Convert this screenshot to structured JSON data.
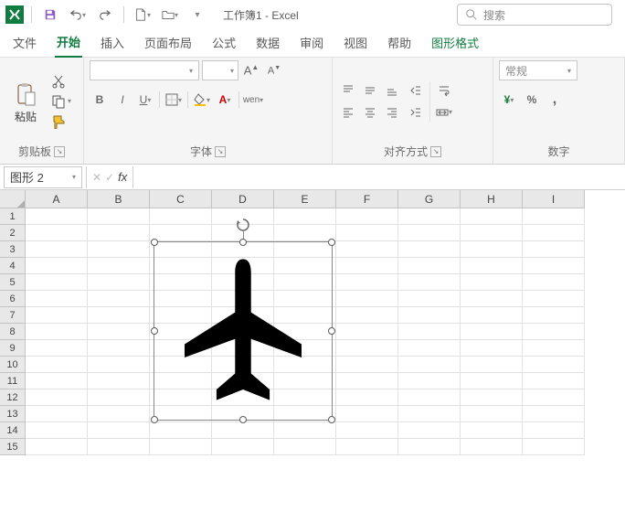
{
  "title": "工作簿1 - Excel",
  "search": {
    "placeholder": "搜索"
  },
  "tabs": {
    "file": "文件",
    "home": "开始",
    "insert": "插入",
    "layout": "页面布局",
    "formulas": "公式",
    "data": "数据",
    "review": "审阅",
    "view": "视图",
    "help": "帮助",
    "shapeformat": "图形格式"
  },
  "ribbon": {
    "clipboard": {
      "caption": "剪贴板",
      "paste": "粘贴"
    },
    "font": {
      "caption": "字体",
      "bold": "B",
      "italic": "I",
      "underline": "U"
    },
    "alignment": {
      "caption": "对齐方式",
      "wen": "wen"
    },
    "number": {
      "caption": "数字",
      "general": "常规",
      "pct": "%",
      "comma": ",",
      "currency": "¥"
    }
  },
  "name_box": "图形 2",
  "columns": [
    "A",
    "B",
    "C",
    "D",
    "E",
    "F",
    "G",
    "H",
    "I"
  ],
  "rows": [
    "1",
    "2",
    "3",
    "4",
    "5",
    "6",
    "7",
    "8",
    "9",
    "10",
    "11",
    "12",
    "13",
    "14",
    "15"
  ],
  "icons": {
    "save": "save-icon",
    "undo": "undo-icon",
    "redo": "redo-icon",
    "new": "new-file-icon",
    "open": "open-icon",
    "search": "search-icon"
  }
}
